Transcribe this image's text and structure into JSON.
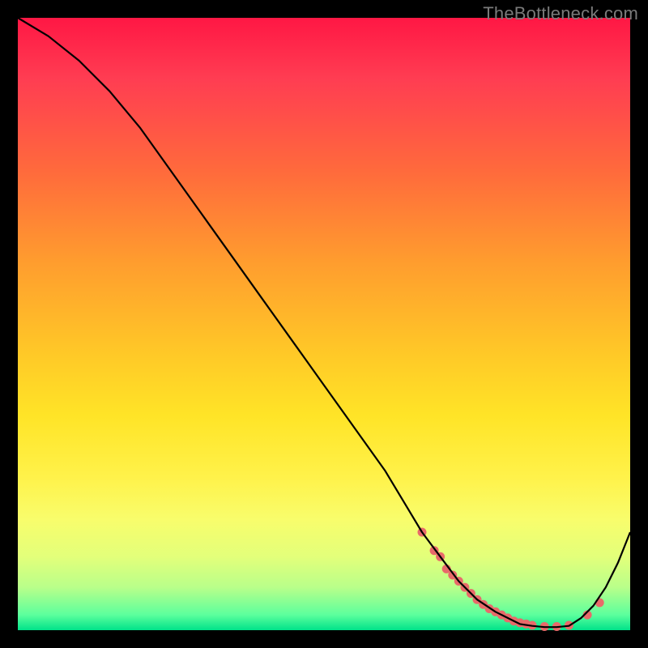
{
  "watermark": "TheBottleneck.com",
  "chart_data": {
    "type": "line",
    "title": "",
    "xlabel": "",
    "ylabel": "",
    "xlim": [
      0,
      100
    ],
    "ylim": [
      0,
      100
    ],
    "grid": false,
    "legend": false,
    "series": [
      {
        "name": "bottleneck-curve",
        "color": "#000000",
        "x": [
          0,
          5,
          10,
          15,
          20,
          25,
          30,
          35,
          40,
          45,
          50,
          55,
          60,
          63,
          66,
          69,
          72,
          75,
          78,
          80,
          82,
          84,
          86,
          88,
          90,
          92,
          94,
          96,
          98,
          100
        ],
        "y": [
          100,
          97,
          93,
          88,
          82,
          75,
          68,
          61,
          54,
          47,
          40,
          33,
          26,
          21,
          16,
          12,
          8,
          5,
          3,
          2,
          1,
          0.7,
          0.5,
          0.5,
          0.7,
          2,
          4,
          7,
          11,
          16
        ]
      }
    ],
    "markers": {
      "name": "highlight-dots",
      "color": "#e86a6a",
      "x": [
        66,
        68,
        69,
        70,
        71,
        72,
        73,
        74,
        75,
        76,
        77,
        78,
        79,
        80,
        81,
        82,
        83,
        84,
        86,
        88,
        90,
        93,
        95
      ],
      "y": [
        16,
        13,
        12,
        10,
        9,
        8,
        7,
        6,
        5,
        4.2,
        3.5,
        3,
        2.5,
        2,
        1.5,
        1.2,
        1,
        0.8,
        0.6,
        0.6,
        0.8,
        2.5,
        4.5
      ]
    }
  }
}
